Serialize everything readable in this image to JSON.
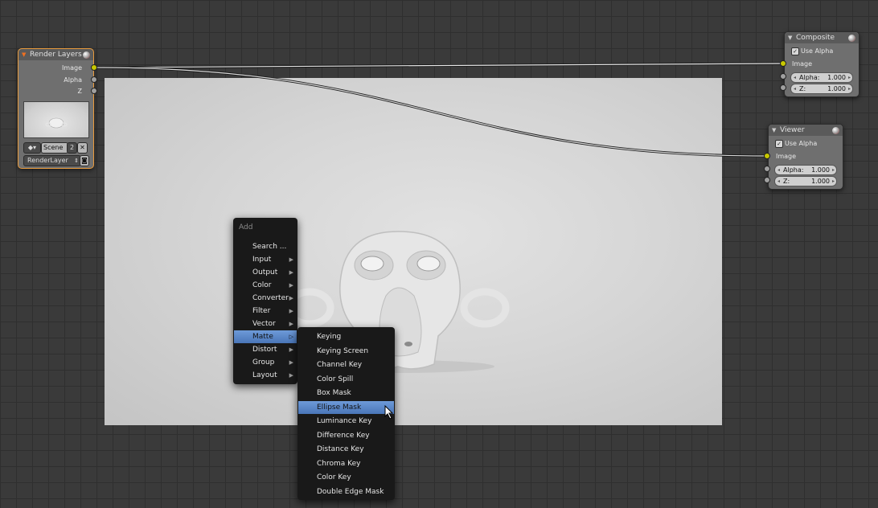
{
  "nodes": {
    "render_layers": {
      "title": "Render Layers",
      "outputs": [
        "Image",
        "Alpha",
        "Z"
      ],
      "scene_label": "Scene",
      "scene_users": "2",
      "layer_label": "RenderLayer"
    },
    "composite": {
      "title": "Composite",
      "use_alpha_label": "Use Alpha",
      "input_label": "Image",
      "alpha_label": "Alpha:",
      "alpha_value": "1.000",
      "z_label": "Z:",
      "z_value": "1.000"
    },
    "viewer": {
      "title": "Viewer",
      "use_alpha_label": "Use Alpha",
      "input_label": "Image",
      "alpha_label": "Alpha:",
      "alpha_value": "1.000",
      "z_label": "Z:",
      "z_value": "1.000"
    }
  },
  "add_menu": {
    "title": "Add",
    "items": [
      "Search ...",
      "Input",
      "Output",
      "Color",
      "Converter",
      "Filter",
      "Vector",
      "Matte",
      "Distort",
      "Group",
      "Layout"
    ],
    "highlighted": "Matte"
  },
  "matte_submenu": {
    "items": [
      "Keying",
      "Keying Screen",
      "Channel Key",
      "Color Spill",
      "Box Mask",
      "Ellipse Mask",
      "Luminance Key",
      "Difference Key",
      "Distance Key",
      "Chroma Key",
      "Color Key",
      "Double Edge Mask"
    ],
    "highlighted": "Ellipse Mask"
  },
  "colors": {
    "highlight": "#5a86c8",
    "socket_image": "#c8c800",
    "socket_value": "#a0a0a0",
    "active_node_border": "#e89a3c"
  }
}
